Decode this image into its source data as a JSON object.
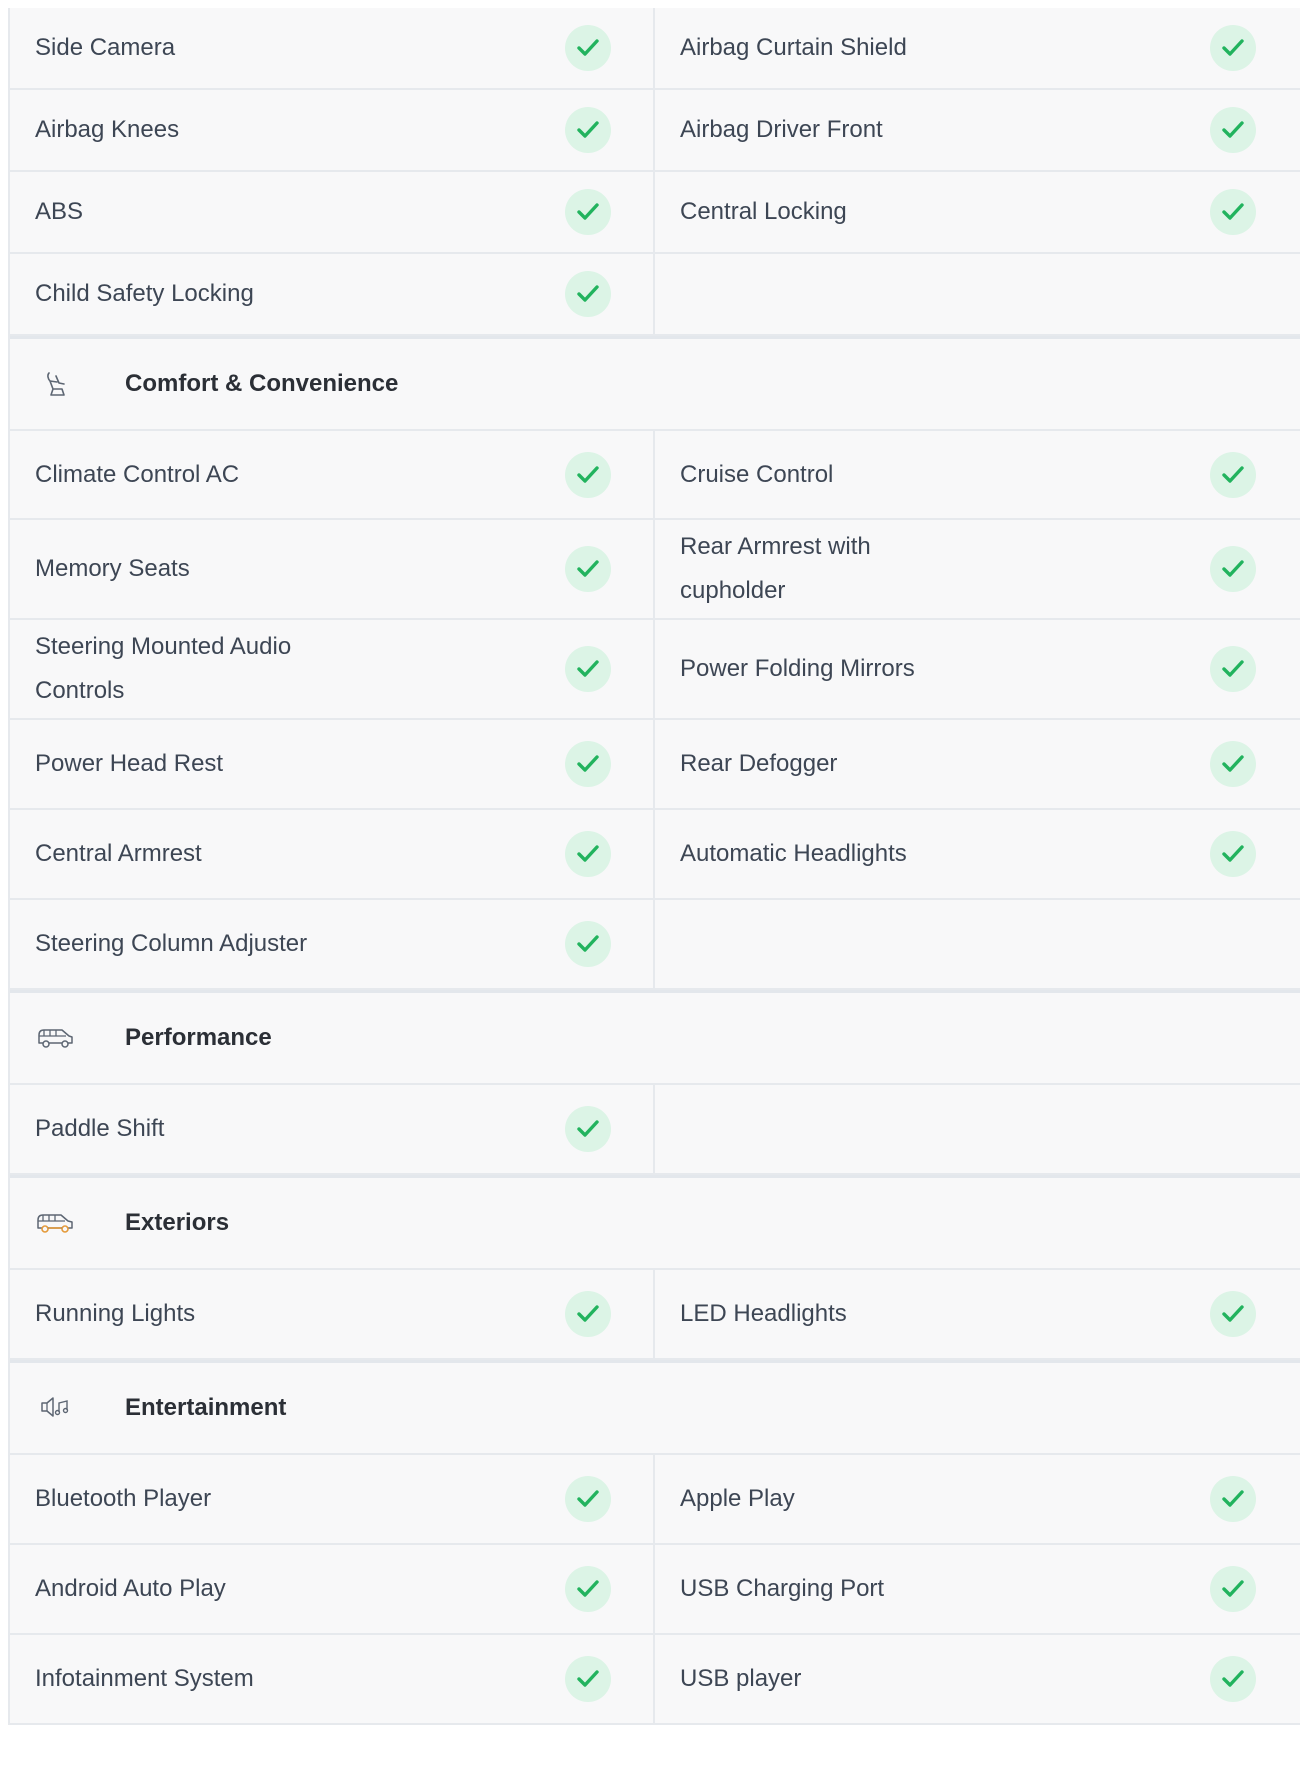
{
  "safety_rows": [
    {
      "left": "Side Camera",
      "right": "Airbag Curtain Shield"
    },
    {
      "left": "Airbag Knees",
      "right": "Airbag Driver Front"
    },
    {
      "left": "ABS",
      "right": "Central Locking"
    },
    {
      "left": "Child Safety Locking",
      "right": ""
    }
  ],
  "comfort": {
    "icon": "seat-icon",
    "title": "Comfort & Convenience",
    "rows": [
      {
        "left": "Climate Control AC",
        "right": "Cruise Control"
      },
      {
        "left": "Memory Seats",
        "right": "Rear Armrest with cupholder"
      },
      {
        "left": "Steering Mounted Audio Controls",
        "right": "Power Folding Mirrors"
      },
      {
        "left": "Power Head Rest",
        "right": "Rear Defogger"
      },
      {
        "left": "Central Armrest",
        "right": "Automatic Headlights"
      },
      {
        "left": "Steering Column Adjuster",
        "right": ""
      }
    ]
  },
  "performance": {
    "icon": "car-icon",
    "title": "Performance",
    "rows": [
      {
        "left": "Paddle Shift",
        "right": ""
      }
    ]
  },
  "exteriors": {
    "icon": "car-exterior-icon",
    "title": "Exteriors",
    "rows": [
      {
        "left": "Running Lights",
        "right": "LED Headlights"
      }
    ]
  },
  "entertainment": {
    "icon": "speaker-icon",
    "title": "Entertainment",
    "rows": [
      {
        "left": "Bluetooth Player",
        "right": "Apple Play"
      },
      {
        "left": "Android Auto Play",
        "right": "USB Charging Port"
      },
      {
        "left": "Infotainment System",
        "right": "USB player"
      }
    ]
  },
  "colors": {
    "check_green": "#22b35e",
    "check_bg": "#dcf4e6",
    "exterior_icon_accent": "#e49a3a"
  }
}
